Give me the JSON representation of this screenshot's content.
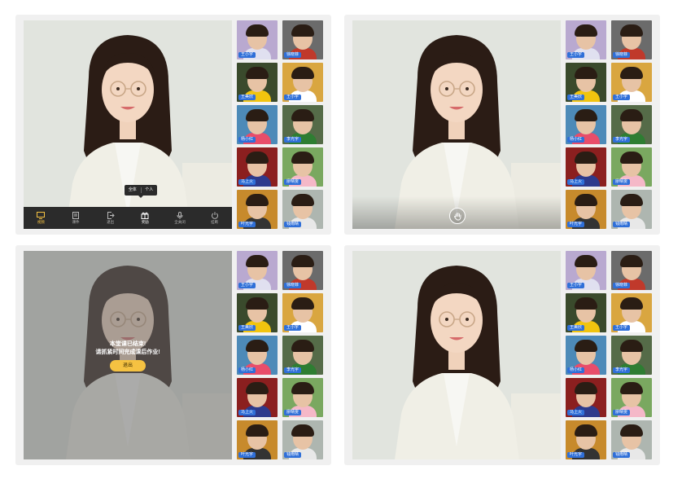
{
  "students": [
    "王小宇",
    "徐晓菲",
    "王美欣",
    "王小宇",
    "杨小红",
    "李光宇",
    "马上火",
    "廖晴雯",
    "叶光宇",
    "钱雨晴"
  ],
  "thumb_colors": [
    "#b9a9d0",
    "#6b6b6b",
    "#3a4a2c",
    "#d9a640",
    "#4d8ab8",
    "#556b48",
    "#8b1f1f",
    "#7aa860",
    "#c78a2c",
    "#aeb6b0"
  ],
  "toolbar": {
    "items": [
      {
        "label": "视频",
        "icon": "monitor-icon",
        "active": true
      },
      {
        "label": "课件",
        "icon": "document-icon",
        "active": false
      },
      {
        "label": "退出",
        "icon": "exit-icon",
        "active": false
      },
      {
        "label": "奖励",
        "icon": "gift-icon",
        "active": false
      },
      {
        "label": "全关闭",
        "icon": "microphone-icon",
        "active": false
      },
      {
        "label": "挂断",
        "icon": "power-icon",
        "active": false
      }
    ],
    "popup": {
      "all": "全体",
      "single": "个人"
    }
  },
  "end_dialog": {
    "line1": "本堂课已结束!",
    "line2": "请抓紧时间完成课后作业!",
    "exit_label": "退出"
  },
  "colors": {
    "accent": "#f5c242",
    "tag_blue": "#2f6fd8",
    "toolbar_bg": "#2b2b2b"
  }
}
